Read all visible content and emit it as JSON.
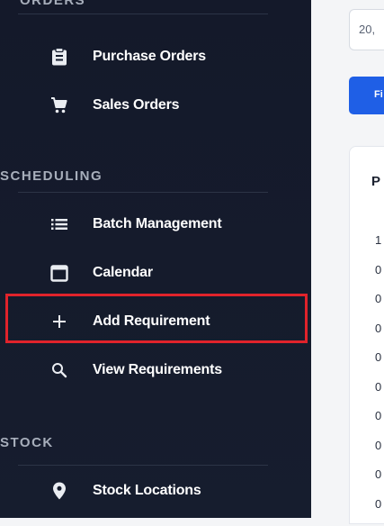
{
  "sidebar": {
    "sections": {
      "orders": "ORDERS",
      "scheduling": "SCHEDULING",
      "stock": "STOCK"
    },
    "items": [
      {
        "label": "Purchase Orders",
        "icon": "clipboard-icon"
      },
      {
        "label": "Sales Orders",
        "icon": "cart-icon"
      },
      {
        "label": "Batch Management",
        "icon": "list-icon"
      },
      {
        "label": "Calendar",
        "icon": "calendar-icon"
      },
      {
        "label": "Add Requirement",
        "icon": "plus-icon",
        "highlighted": true
      },
      {
        "label": "View Requirements",
        "icon": "search-icon"
      },
      {
        "label": "Stock Locations",
        "icon": "map-pin-icon"
      }
    ]
  },
  "main": {
    "date_input_value": "20,",
    "filter_button_label": "Fi",
    "card": {
      "title": "P",
      "values": [
        "1",
        "0",
        "0",
        "0",
        "0",
        "0",
        "0",
        "0",
        "0",
        "0"
      ]
    }
  },
  "colors": {
    "sidebar_bg": "#161d2e",
    "highlight": "#e0232b",
    "primary_button": "#1f5fe6"
  }
}
